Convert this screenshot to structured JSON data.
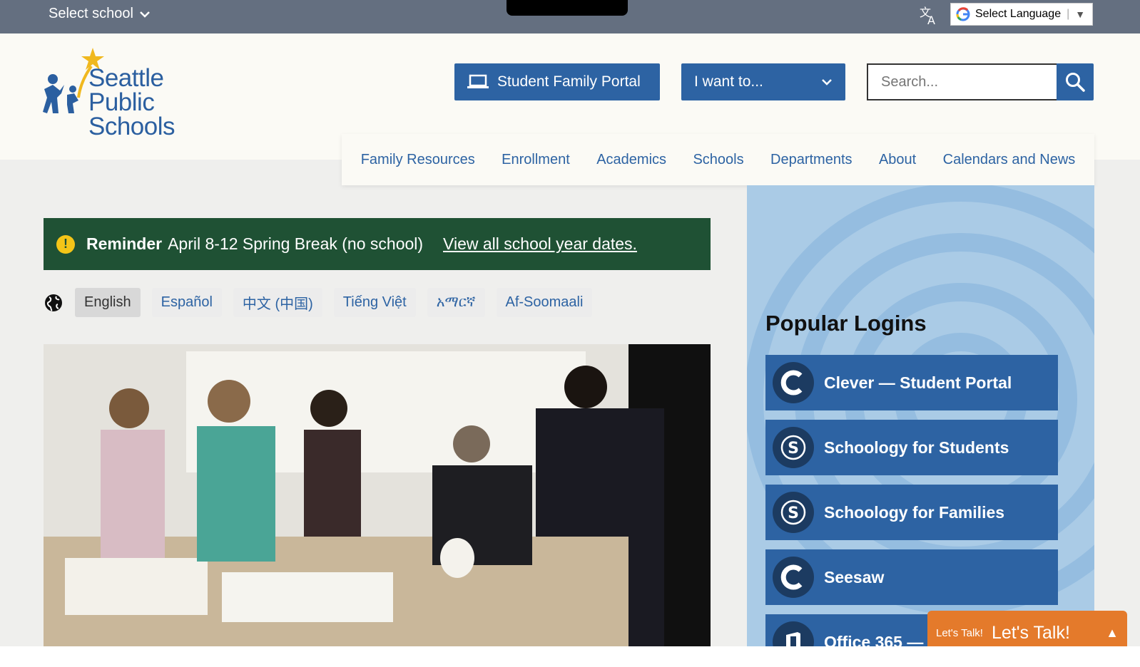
{
  "topbar": {
    "select_school": "Select school",
    "language_select_label": "Select Language"
  },
  "header": {
    "logo_line1": "Seattle Public",
    "logo_line2": "Schools",
    "portal_button": "Student Family Portal",
    "iwant_button": "I want to...",
    "search_placeholder": "Search..."
  },
  "nav": {
    "items": [
      "Family Resources",
      "Enrollment",
      "Academics",
      "Schools",
      "Departments",
      "About",
      "Calendars and News"
    ]
  },
  "alert": {
    "label": "Reminder",
    "message": "April 8-12 Spring Break (no school)",
    "link": "View all school year dates."
  },
  "languages": {
    "items": [
      "English",
      "Español",
      "中文 (中国)",
      "Tiếng Việt",
      "አማርኛ",
      "Af-Soomaali"
    ],
    "active": "English"
  },
  "sidebar": {
    "title": "Popular Logins",
    "logins": [
      {
        "label": "Clever — Student Portal",
        "icon": "clever-icon"
      },
      {
        "label": "Schoology for Students",
        "icon": "schoology-icon"
      },
      {
        "label": "Schoology for Families",
        "icon": "schoology-icon"
      },
      {
        "label": "Seesaw",
        "icon": "seesaw-icon"
      },
      {
        "label": "Office 365 —",
        "icon": "office-icon"
      }
    ]
  },
  "chat": {
    "small_label": "Let's Talk!",
    "big_label": "Let's Talk!"
  },
  "colors": {
    "primary_blue": "#2d63a3",
    "alert_green": "#1f5134",
    "topbar_gray": "#646f80",
    "chat_orange": "#e47a2b",
    "sidebar_light_blue": "#aacbe6"
  }
}
